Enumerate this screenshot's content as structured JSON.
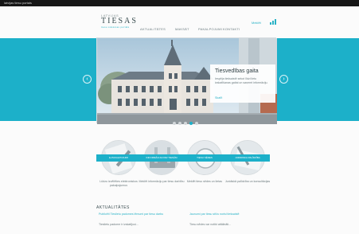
{
  "browser": {
    "title": "latvijas tiesu portals"
  },
  "header": {
    "logo_small": "LATVIJAS",
    "logo_big": "TIESAS",
    "logo_tagline": "tiesu sistēmas portāls",
    "util_link": "Meklēt",
    "util_icon": "signal-icon"
  },
  "nav": {
    "items": [
      "AKTUALITĀTES",
      "MAKSĀT",
      "PAKALPOJUMI",
      "KONTAKTI"
    ]
  },
  "slider": {
    "title": "Tiesvedības gaita",
    "text": "Iespēja tiešsaistē sekot līdzi lietu izskatīšanas gaitai un saņemt informāciju.",
    "link": "Skatīt",
    "prev": "‹",
    "next": "›",
    "dots": 5,
    "active_dot": 3,
    "accent": "#1cb0c9"
  },
  "features": [
    {
      "ribbon": "E-PAKALPOJUMI",
      "desc": "Lūdzu izvēlēties elektroniskos pakalpojumus"
    },
    {
      "ribbon": "INFORMĀCIJA PAR TIESĀM",
      "desc": "Meklēt informāciju par tiesu darbību"
    },
    {
      "ribbon": "TIESU SĒDES",
      "desc": "Meklēt tiesu sēdes un lietas"
    },
    {
      "ribbon": "JURIDISKA PALĪDZĪBA",
      "desc": "Juridiskā palīdzība un konsultācijas"
    }
  ],
  "news": {
    "heading": "AKTUALITĀTES",
    "items": [
      {
        "title": "Publicēti Tieslietu padomes lēmumi par tiesu darbu",
        "text": "Tieslietu padome ir izskatījusi..."
      },
      {
        "title": "Jaunumi par tiesu sēžu norisi tiešsaistē",
        "text": "Tiesu sēdes var notikt attālināti..."
      }
    ]
  }
}
